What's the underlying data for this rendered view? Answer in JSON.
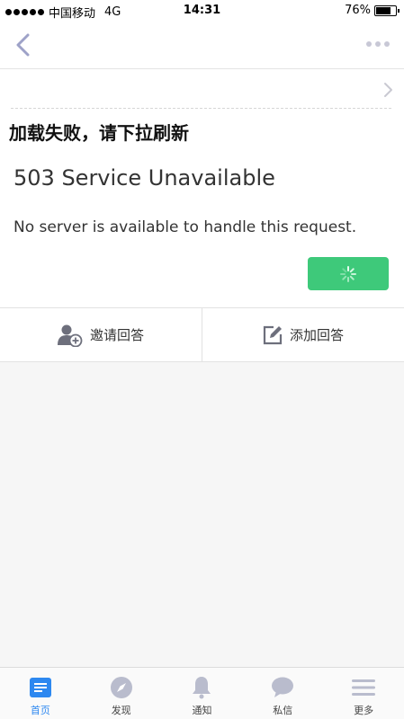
{
  "status_bar": {
    "carrier": "中国移动",
    "network": "4G",
    "time": "14:31",
    "battery": "76%",
    "battery_level": 0.76
  },
  "page": {
    "title": "加载失败，请下拉刷新",
    "error_heading": "503 Service Unavailable",
    "error_message": "No server is available to handle this request."
  },
  "actions": {
    "invite": "邀请回答",
    "add": "添加回答"
  },
  "tabs": [
    {
      "label": "首页",
      "icon": "home-icon",
      "active": true
    },
    {
      "label": "发现",
      "icon": "compass-icon"
    },
    {
      "label": "通知",
      "icon": "bell-icon"
    },
    {
      "label": "私信",
      "icon": "chat-bubble-icon"
    },
    {
      "label": "更多",
      "icon": "menu-icon"
    }
  ],
  "colors": {
    "accent": "#2d88f0",
    "green_button": "#3ec97a",
    "icon_muted": "#b9bccd"
  }
}
